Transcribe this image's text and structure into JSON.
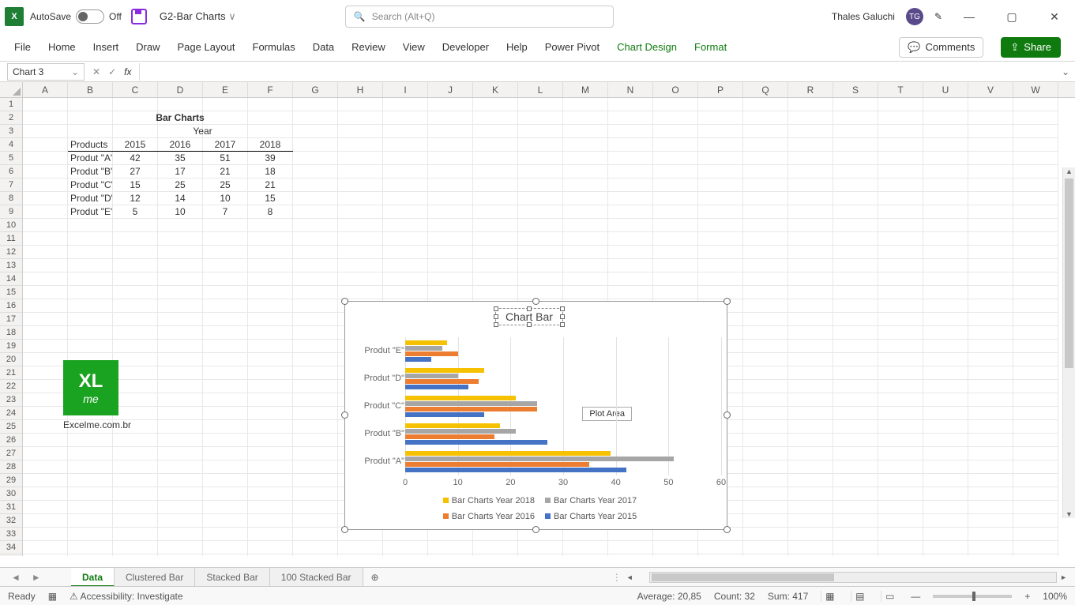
{
  "title_bar": {
    "autosave_label": "AutoSave",
    "autosave_state": "Off",
    "filename": "G2-Bar Charts",
    "search_placeholder": "Search (Alt+Q)",
    "user_name": "Thales Galuchi",
    "user_initials": "TG"
  },
  "ribbon": {
    "tabs": [
      "File",
      "Home",
      "Insert",
      "Draw",
      "Page Layout",
      "Formulas",
      "Data",
      "Review",
      "View",
      "Developer",
      "Help",
      "Power Pivot",
      "Chart Design",
      "Format"
    ],
    "comments_label": "Comments",
    "share_label": "Share"
  },
  "name_box": "Chart 3",
  "columns": [
    "A",
    "B",
    "C",
    "D",
    "E",
    "F",
    "G",
    "H",
    "I",
    "J",
    "K",
    "L",
    "M",
    "N",
    "O",
    "P",
    "Q",
    "R",
    "S",
    "T",
    "U",
    "V",
    "W"
  ],
  "row_count": 36,
  "table": {
    "title": "Bar Charts",
    "year_header": "Year",
    "products_header": "Products",
    "years": [
      "2015",
      "2016",
      "2017",
      "2018"
    ],
    "rows": [
      {
        "name": "Produt \"A\"",
        "v": [
          42,
          35,
          51,
          39
        ]
      },
      {
        "name": "Produt \"B\"",
        "v": [
          27,
          17,
          21,
          18
        ]
      },
      {
        "name": "Produt \"C\"",
        "v": [
          15,
          25,
          25,
          21
        ]
      },
      {
        "name": "Produt \"D\"",
        "v": [
          12,
          14,
          10,
          15
        ]
      },
      {
        "name": "Produt \"E\"",
        "v": [
          5,
          10,
          7,
          8
        ]
      }
    ]
  },
  "logo_url": "Excelme.com.br",
  "chart": {
    "title": "Chart Bar",
    "plot_area_tip": "Plot Area",
    "legend": [
      "Bar Charts Year 2018",
      "Bar Charts Year 2017",
      "Bar Charts Year 2016",
      "Bar Charts Year 2015"
    ],
    "x_ticks": [
      0,
      10,
      20,
      30,
      40,
      50,
      60
    ]
  },
  "chart_data": {
    "type": "bar",
    "orientation": "horizontal",
    "title": "Chart Bar",
    "categories": [
      "Produt \"A\"",
      "Produt \"B\"",
      "Produt \"C\"",
      "Produt \"D\"",
      "Produt \"E\""
    ],
    "series": [
      {
        "name": "Bar Charts Year 2018",
        "color": "#f6c100",
        "values": [
          39,
          18,
          21,
          15,
          8
        ]
      },
      {
        "name": "Bar Charts Year 2017",
        "color": "#a6a6a6",
        "values": [
          51,
          21,
          25,
          10,
          7
        ]
      },
      {
        "name": "Bar Charts Year 2016",
        "color": "#ed7d31",
        "values": [
          35,
          17,
          25,
          14,
          10
        ]
      },
      {
        "name": "Bar Charts Year 2015",
        "color": "#4472c4",
        "values": [
          42,
          27,
          15,
          12,
          5
        ]
      }
    ],
    "xlabel": "",
    "ylabel": "",
    "xlim": [
      0,
      60
    ],
    "legend_position": "bottom"
  },
  "sheets": {
    "tabs": [
      "Data",
      "Clustered Bar",
      "Stacked Bar",
      "100 Stacked Bar"
    ],
    "active": "Data"
  },
  "status": {
    "ready": "Ready",
    "accessibility": "Accessibility: Investigate",
    "average": "Average: 20,85",
    "count": "Count: 32",
    "sum": "Sum: 417",
    "zoom": "100%"
  }
}
